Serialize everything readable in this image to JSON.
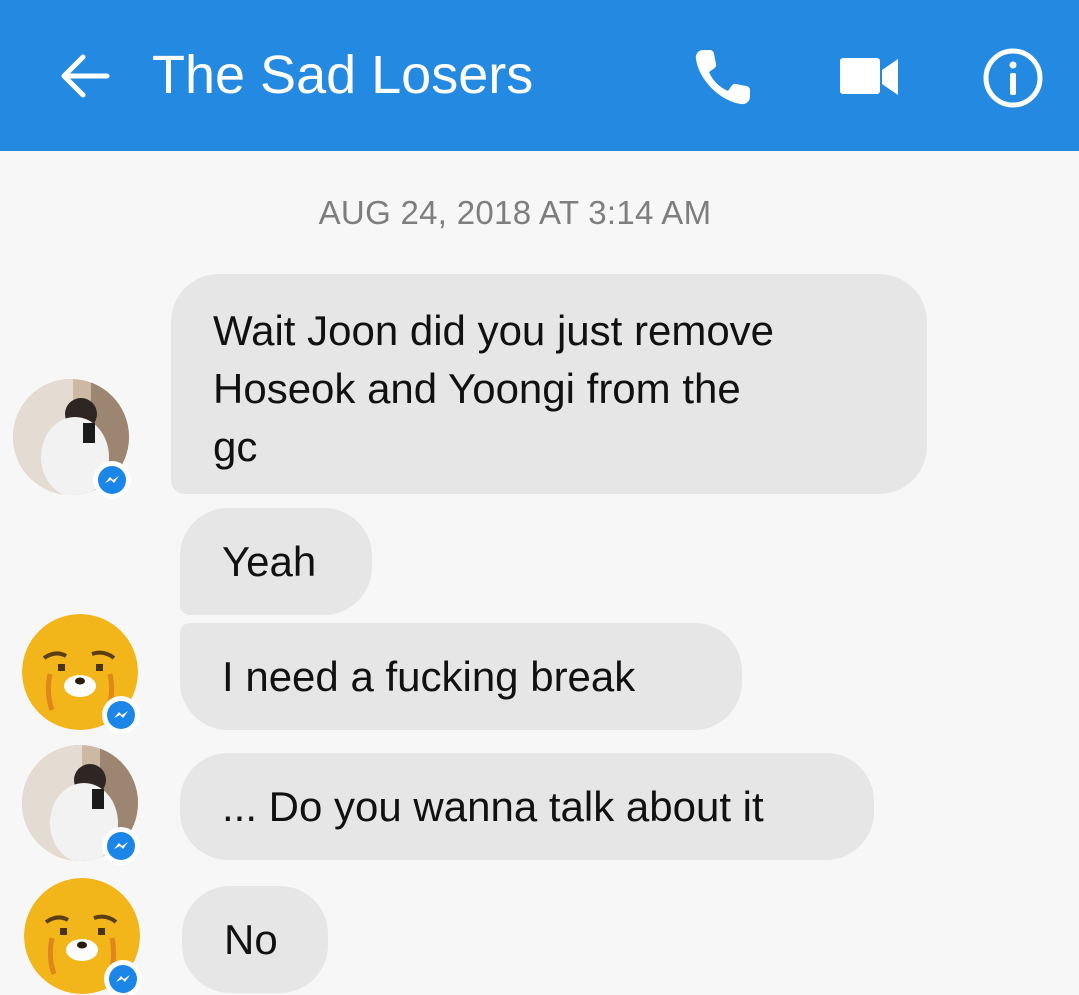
{
  "header": {
    "title": "The Sad Losers",
    "back_icon": "arrow-left-icon",
    "phone_icon": "phone-icon",
    "video_icon": "video-camera-icon",
    "info_icon": "info-icon",
    "bg_color": "#2389e1"
  },
  "conversation": {
    "timestamp": "AUG 24, 2018 AT 3:14 AM",
    "messages": [
      {
        "sender_avatar": "photo-avatar",
        "text_lines": [
          "Wait Joon did you just remove",
          "Hoseok and Yoongi from the",
          "gc"
        ]
      },
      {
        "sender_avatar": "ryan-character-avatar",
        "text": "Yeah"
      },
      {
        "sender_avatar": "ryan-character-avatar",
        "text": "I need a fucking break"
      },
      {
        "sender_avatar": "photo-avatar",
        "text": "... Do you wanna talk about it"
      },
      {
        "sender_avatar": "ryan-character-avatar",
        "text": "No"
      }
    ],
    "bubble_color": "#e6e6e6",
    "badge_icon": "messenger-badge-icon"
  }
}
